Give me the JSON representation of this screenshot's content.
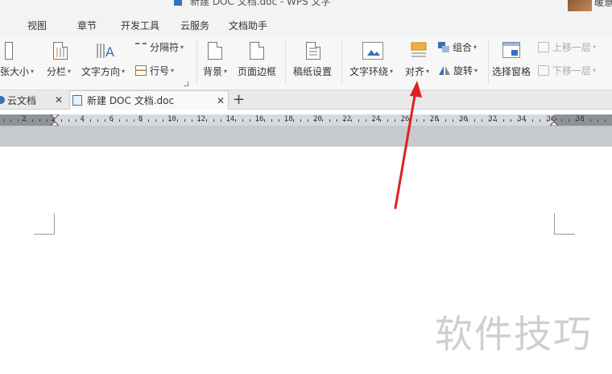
{
  "titlebar": {
    "title": "新建 DOC 文档.doc - WPS 文字",
    "user": "暖意"
  },
  "menu": {
    "items": [
      "视图",
      "章节",
      "开发工具",
      "云服务",
      "文档助手"
    ]
  },
  "ribbon": {
    "paper_size": "纸张大小",
    "columns": "分栏",
    "text_direction": "文字方向",
    "break": "分隔符",
    "line_number": "行号",
    "background": "背景",
    "page_border": "页面边框",
    "manuscript": "稿纸设置",
    "text_wrap": "文字环绕",
    "align": "对齐",
    "group": "组合",
    "rotate": "旋转",
    "selection_pane": "选择窗格",
    "bring_forward": "上移一层",
    "send_backward": "下移一层"
  },
  "tabs": {
    "cloud_docs": "云文档",
    "doc_tab": "新建 DOC 文档.doc"
  },
  "ruler": {
    "labels": [
      "2",
      "2",
      "4",
      "6",
      "8",
      "10",
      "12",
      "14",
      "16",
      "18",
      "20",
      "22",
      "24",
      "26",
      "28",
      "30",
      "32",
      "34",
      "36",
      "38"
    ]
  },
  "watermark": "软件技巧",
  "colors": {
    "arrow": "#e02020",
    "watermark": "#cfcfcf"
  }
}
